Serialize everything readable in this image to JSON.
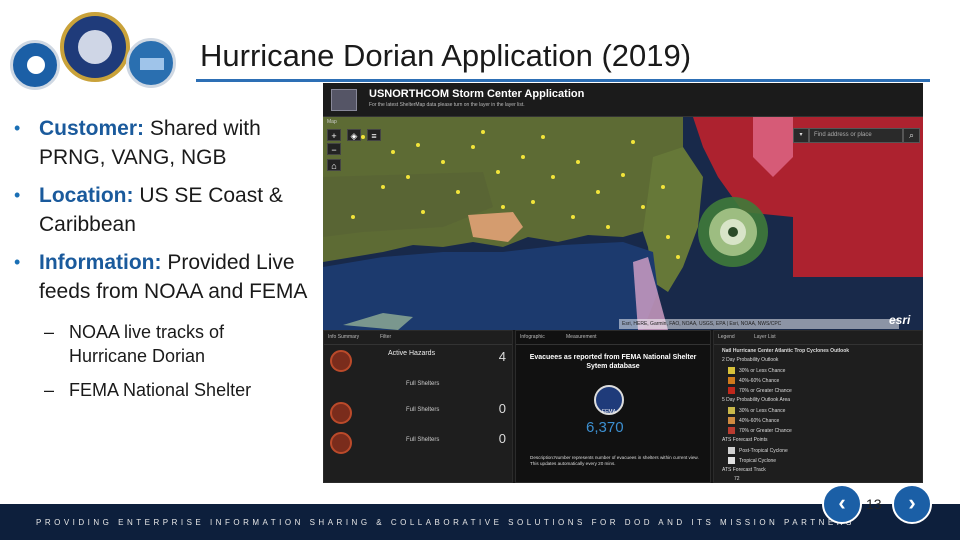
{
  "title": "Hurricane Dorian Application (2019)",
  "logos": [
    {
      "name": "accelerator-seal",
      "color": "#1b5fa6"
    },
    {
      "name": "air-force-seal",
      "color": "#1f3b7a"
    },
    {
      "name": "pwc-seal",
      "color": "#2a6fb0"
    }
  ],
  "bullets": [
    {
      "label": "Customer:",
      "text": " Shared with PRNG, VANG, NGB"
    },
    {
      "label": "Location:",
      "text": " US SE Coast & Caribbean"
    },
    {
      "label": "Information:",
      "text": " Provided Live feeds from NOAA and FEMA"
    }
  ],
  "subbullets": [
    "NOAA live tracks of Hurricane Dorian",
    "FEMA National Shelter"
  ],
  "app": {
    "title": "USNORTHCOM Storm Center Application",
    "subtitle": "For the latest ShelterMap data please turn on the layer in the layer list.",
    "map_label": "Map",
    "search_placeholder": "Find address or place",
    "attribution": "Esri, HERE, Garmin, FAO, NOAA, USGS, EPA | Esri, NOAA, NWS/CPC",
    "esri": "esri",
    "hazard_panel": {
      "tabs": [
        "Info Summary",
        "Filter"
      ],
      "rows": [
        {
          "label": "Active Hazards",
          "sub": "Full Shelters",
          "count": "4"
        },
        {
          "label": "",
          "sub": "Full Shelters",
          "count": "0"
        },
        {
          "label": "",
          "sub": "Full Shelters",
          "count": "0"
        }
      ]
    },
    "fema_panel": {
      "tabs": [
        "Infographic",
        "Measurement"
      ],
      "title": "Evacuees as reported from FEMA National Shelter Sytem database",
      "seal_text": "FEMA",
      "value": "6,370",
      "description": "Description:Number represents number of evacuees in shelters within current view. This updates automatically every 20 mins."
    },
    "legend_panel": {
      "tabs": [
        "Legend",
        "Layer List"
      ],
      "heading": "Natl Hurricane Center Atlantic Trop Cyclones Outlook",
      "items": [
        {
          "text": "2 Day Probability Outlook",
          "color": ""
        },
        {
          "text": "30% or Less Chance",
          "color": "#d8c23a"
        },
        {
          "text": "40%-60% Chance",
          "color": "#d07a1c"
        },
        {
          "text": "70% or Greater Chance",
          "color": "#c0281c"
        },
        {
          "text": "5 Day Probability Outlook Area",
          "color": ""
        },
        {
          "text": "30% or Less Chance",
          "color": "#c9b84a"
        },
        {
          "text": "40%-60% Chance",
          "color": "#cf8a40"
        },
        {
          "text": "70% or Greater Chance",
          "color": "#b93b30"
        },
        {
          "text": "ATS Forecast Points",
          "color": ""
        },
        {
          "text": "Post-Tropical Cyclone",
          "color": "#cfcfcf"
        },
        {
          "text": "Tropical Cyclone",
          "color": "#e0e0e0"
        },
        {
          "text": "ATS Forecast Track",
          "color": ""
        }
      ],
      "last_value": "72"
    }
  },
  "footer": "PROVIDING ENTERPRISE INFORMATION SHARING & COLLABORATIVE SOLUTIONS FOR DOD AND ITS MISSION PARTNERS",
  "page_number": "13",
  "nav": {
    "prev_icon": "chevron-left-icon",
    "next_icon": "chevron-right-icon"
  },
  "accent": "#1b5fa6"
}
